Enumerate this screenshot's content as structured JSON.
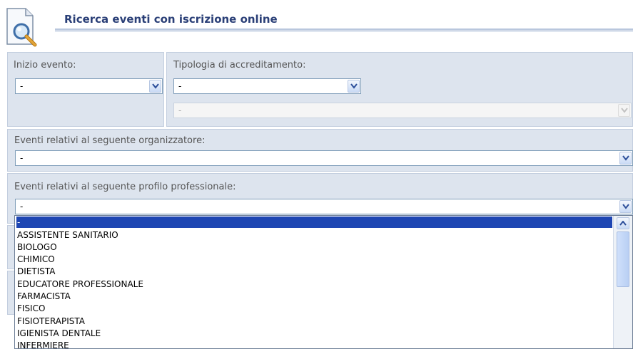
{
  "header": {
    "title": "Ricerca eventi con iscrizione online",
    "icon": "document-search-icon"
  },
  "form": {
    "inizio_evento": {
      "label": "Inizio evento:",
      "value": "-"
    },
    "tipologia": {
      "label": "Tipologia di accreditamento:",
      "value": "-",
      "secondary_value": "-"
    },
    "organizzatore": {
      "label": "Eventi relativi al seguente organizzatore:",
      "value": "-"
    },
    "profilo": {
      "label": "Eventi relativi al seguente profilo professionale:",
      "value": "-"
    }
  },
  "dropdown": {
    "options": [
      "-",
      "ASSISTENTE SANITARIO",
      "BIOLOGO",
      "CHIMICO",
      "DIETISTA",
      "EDUCATORE PROFESSIONALE",
      "FARMACISTA",
      "FISICO",
      "FISIOTERAPISTA",
      "IGIENISTA DENTALE",
      "INFERMIERE"
    ],
    "selected_index": 0
  },
  "colors": {
    "title": "#2a3f77",
    "panel_bg": "#dde4ee",
    "selected_option_bg": "#1e46b3"
  }
}
